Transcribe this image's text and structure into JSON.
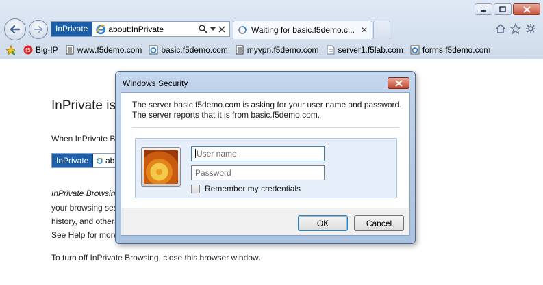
{
  "browser": {
    "inprivate_label": "InPrivate",
    "address": "about:InPrivate",
    "tab_title": "Waiting for basic.f5demo.c...",
    "tab_close": "✕",
    "favorites": [
      {
        "label": "Big-IP",
        "icon": "f5-icon"
      },
      {
        "label": "www.f5demo.com",
        "icon": "page-icon"
      },
      {
        "label": "basic.f5demo.com",
        "icon": "ie-page-icon"
      },
      {
        "label": "myvpn.f5demo.com",
        "icon": "page-icon"
      },
      {
        "label": "server1.f5lab.com",
        "icon": "doc-icon"
      },
      {
        "label": "forms.f5demo.com",
        "icon": "ie-page-icon"
      }
    ]
  },
  "page": {
    "title": "InPrivate is",
    "line1": "When InPrivate Br",
    "mini_inprivate": "InPrivate",
    "mini_address": "abo",
    "italic_line": "InPrivate Browsing",
    "line_a": "your browsing ses",
    "line_b": "history, and other",
    "line_c": "See Help for more",
    "footer_line": "To turn off InPrivate Browsing, close this browser window."
  },
  "dialog": {
    "title": "Windows Security",
    "message_1": "The server basic.f5demo.com is asking for your user name and password.",
    "message_2": "The server reports that it is from basic.f5demo.com.",
    "username_placeholder": "User name",
    "password_placeholder": "Password",
    "remember_label": "Remember my credentials",
    "ok_label": "OK",
    "cancel_label": "Cancel"
  },
  "colors": {
    "inprivate_blue": "#1c5fa8",
    "close_red": "#c24a33"
  }
}
